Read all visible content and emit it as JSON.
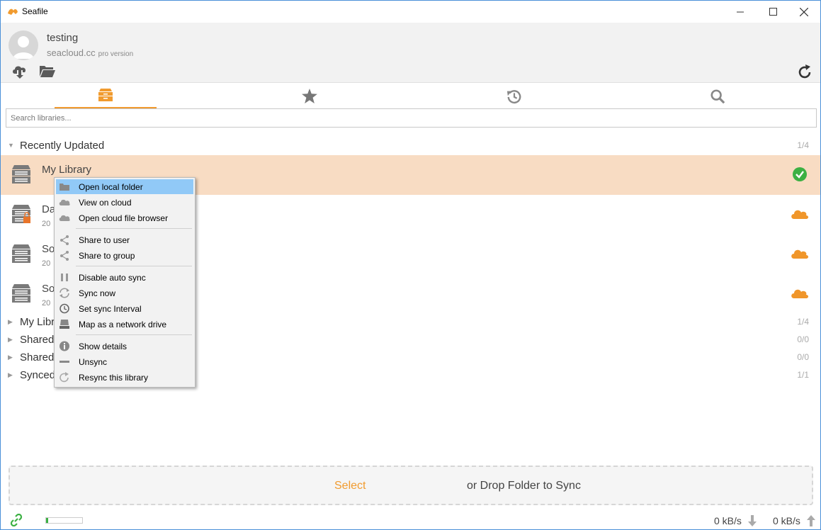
{
  "window": {
    "title": "Seafile"
  },
  "account": {
    "name": "testing",
    "server": "seacloud.cc",
    "edition": "pro version"
  },
  "tabs": [
    {
      "icon": "library-icon",
      "active": true
    },
    {
      "icon": "star-icon",
      "active": false
    },
    {
      "icon": "history-icon",
      "active": false
    },
    {
      "icon": "search-icon",
      "active": false
    }
  ],
  "search": {
    "placeholder": "Search libraries..."
  },
  "sections": {
    "recent": {
      "label": "Recently Updated",
      "count": "1/4"
    },
    "my": {
      "label": "My Libraries",
      "count": "1/4"
    },
    "shared_with_me": {
      "label": "Shared with me",
      "count": "0/0"
    },
    "shared_with_groups": {
      "label": "Shared with groups",
      "count": "0/0"
    },
    "synced": {
      "label": "Synced Libraries",
      "count": "1/1"
    }
  },
  "libraries": [
    {
      "name": "My Library",
      "sub": "",
      "status": "synced",
      "selected": true
    },
    {
      "name": "Da",
      "sub": "20",
      "status": "cloud",
      "locked": true
    },
    {
      "name": "So",
      "sub": "20",
      "status": "cloud"
    },
    {
      "name": "So",
      "sub": "20",
      "status": "cloud"
    }
  ],
  "context_menu": {
    "items": [
      {
        "label": "Open local folder",
        "icon": "folder-icon",
        "hover": true
      },
      {
        "label": "View on cloud",
        "icon": "cloud-icon"
      },
      {
        "label": "Open cloud file browser",
        "icon": "cloud-icon"
      },
      {
        "label": "Share to user",
        "icon": "share-icon"
      },
      {
        "label": "Share to group",
        "icon": "share-icon"
      },
      {
        "label": "Disable auto sync",
        "icon": "pause-icon"
      },
      {
        "label": "Sync now",
        "icon": "sync-icon"
      },
      {
        "label": "Set sync Interval",
        "icon": "clock-icon"
      },
      {
        "label": "Map as a network drive",
        "icon": "drive-icon"
      },
      {
        "label": "Show details",
        "icon": "info-icon"
      },
      {
        "label": "Unsync",
        "icon": "minus-icon"
      },
      {
        "label": "Resync this library",
        "icon": "resync-icon"
      }
    ]
  },
  "dropzone": {
    "select": "Select",
    "text": "or Drop Folder to Sync"
  },
  "status": {
    "download_rate": "0 kB/s",
    "upload_rate": "0 kB/s",
    "progress": 0.05
  },
  "colors": {
    "accent": "#f19b2f",
    "selected_row": "#f8dcc3",
    "synced": "#3cb043",
    "cloud": "#f0962a",
    "menu_hover": "#91c9f7"
  }
}
